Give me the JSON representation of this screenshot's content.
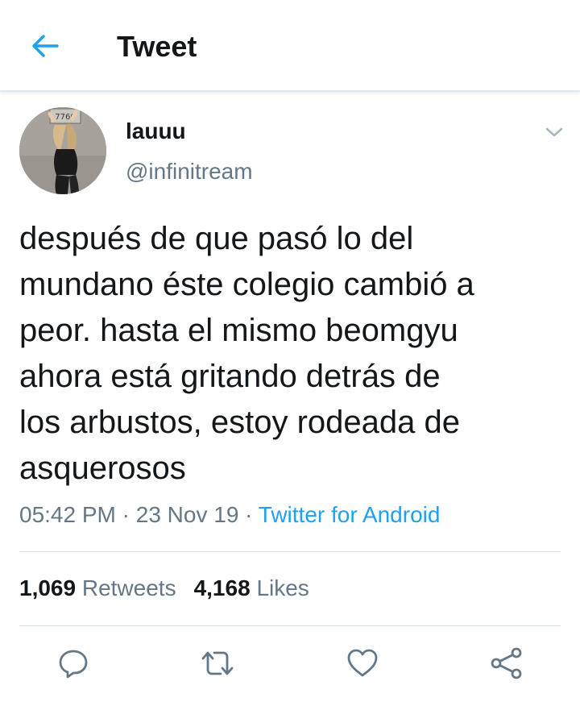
{
  "header": {
    "title": "Tweet",
    "back_icon": "arrow-left-icon",
    "accent": "#1da1f2"
  },
  "tweet": {
    "display_name": "lauuu",
    "handle": "@infinitream",
    "text": "después de que pasó lo del\nmundano éste colegio cambió a\npeor. hasta el mismo beomgyu\nahora está gritando detrás de\nlos arbustos, estoy rodeada de\nasquerosos",
    "time": "05:42 PM",
    "sep1": " · ",
    "date": "23 Nov 19",
    "sep2": " · ",
    "source": "Twitter for Android",
    "avatar_sign_text": "7760"
  },
  "stats": {
    "retweets_count": "1,069",
    "retweets_label": "Retweets",
    "likes_count": "4,168",
    "likes_label": "Likes"
  },
  "actions": [
    {
      "name": "reply",
      "icon": "reply-icon"
    },
    {
      "name": "retweet",
      "icon": "retweet-icon"
    },
    {
      "name": "like",
      "icon": "heart-icon"
    },
    {
      "name": "share",
      "icon": "share-icon"
    }
  ],
  "colors": {
    "primary_text": "#14171a",
    "secondary_text": "#657786",
    "link": "#1da1f2",
    "icon_gray": "#657786",
    "divider": "#d8dfe4"
  }
}
